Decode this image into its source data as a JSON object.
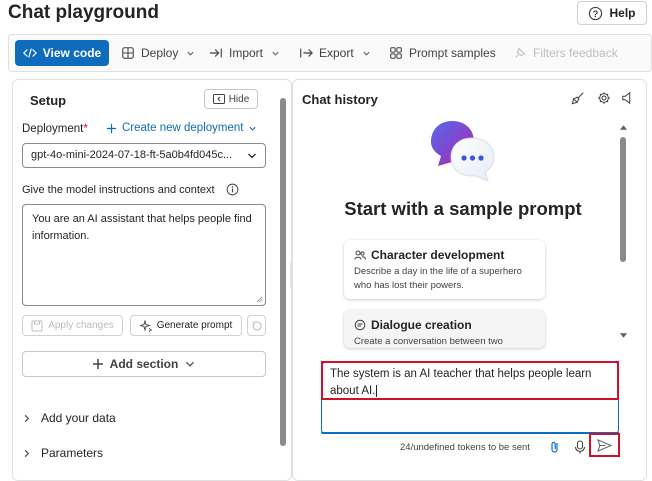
{
  "page": {
    "title": "Chat playground",
    "help_label": "Help"
  },
  "toolbar": {
    "view_code": "View code",
    "deploy": "Deploy",
    "import": "Import",
    "export": "Export",
    "prompt_samples": "Prompt samples",
    "filters_feedback": "Filters feedback"
  },
  "setup": {
    "title": "Setup",
    "hide_label": "Hide",
    "deployment_label": "Deployment",
    "required_mark": "*",
    "create_deployment": "Create new deployment",
    "deployment_value": "gpt-4o-mini-2024-07-18-ft-5a0b4fd045c...",
    "instructions_label": "Give the model instructions and context",
    "system_message": "You are an AI assistant that helps people find information.",
    "apply_changes": "Apply changes",
    "generate_prompt": "Generate prompt",
    "add_section": "Add section",
    "add_your_data": "Add your data",
    "parameters": "Parameters"
  },
  "chat": {
    "title": "Chat history",
    "sample_heading": "Start with a sample prompt",
    "samples": [
      {
        "title": "Character development",
        "description": "Describe a day in the life of a superhero who has lost their powers."
      },
      {
        "title": "Dialogue creation",
        "description": "Create a conversation between two"
      }
    ],
    "input_text": "The system is an AI teacher that helps people learn about AI.",
    "tokens_text": "24/undefined tokens to be sent"
  },
  "colors": {
    "accent": "#0f6cbd",
    "highlight": "#d0112b"
  }
}
